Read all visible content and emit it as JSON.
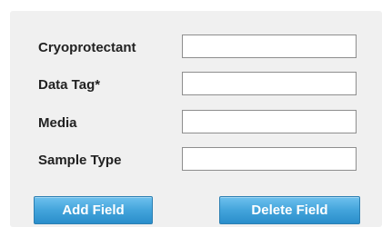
{
  "form": {
    "fields": [
      {
        "label": "Cryoprotectant",
        "value": "",
        "placeholder": ""
      },
      {
        "label": "Data Tag*",
        "value": "",
        "placeholder": ""
      },
      {
        "label": "Media",
        "value": "",
        "placeholder": ""
      },
      {
        "label": "Sample Type",
        "value": "",
        "placeholder": ""
      }
    ],
    "add_button_label": "Add Field",
    "delete_button_label": "Delete Field"
  },
  "colors": {
    "panel_background": "#f0f0f0",
    "button_blue": "#43a4db",
    "label_text": "#222222"
  }
}
